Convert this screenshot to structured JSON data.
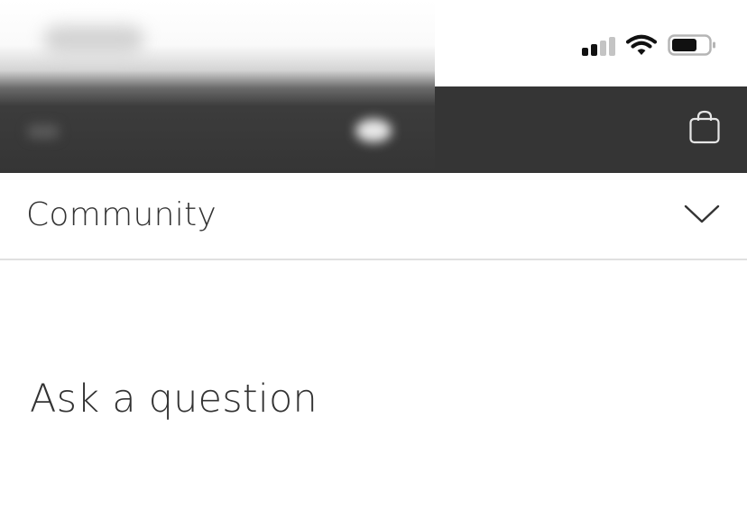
{
  "status_bar": {
    "icons": [
      "signal-icon",
      "wifi-icon",
      "battery-icon"
    ],
    "battery_level": 0.75,
    "signal_bars_active": 2,
    "signal_bars_total": 4
  },
  "nav": {
    "background": "#353535",
    "bag_icon": "bag-icon"
  },
  "section": {
    "label": "Community",
    "toggle_icon": "chevron-down-icon"
  },
  "main": {
    "ask_label": "Ask a question"
  },
  "colors": {
    "text": "#333333",
    "divider": "#e0e0e0",
    "nav_background": "#353535"
  }
}
